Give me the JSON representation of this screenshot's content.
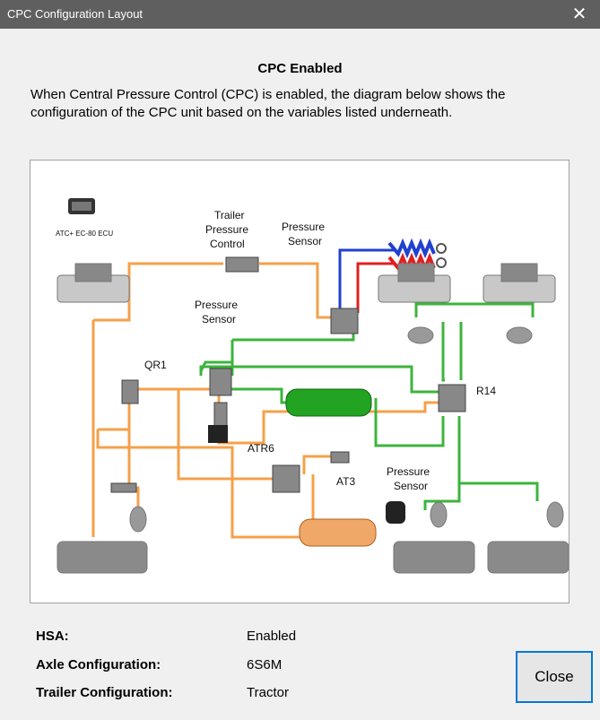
{
  "window": {
    "title": "CPC Configuration Layout",
    "close_glyph": "✕"
  },
  "heading": "CPC Enabled",
  "description": "When Central Pressure Control (CPC) is enabled, the diagram below shows the configuration of the CPC unit based on the variables listed underneath.",
  "diagram": {
    "labels": {
      "ecu": "ATC+ EC-80 ECU",
      "trailer_pressure_control": [
        "Trailer",
        "Pressure",
        "Control"
      ],
      "pressure_sensor_top": [
        "Pressure",
        "Sensor"
      ],
      "pressure_sensor_mid": [
        "Pressure",
        "Sensor"
      ],
      "pressure_sensor_bottom": [
        "Pressure",
        "Sensor"
      ],
      "qr1": "QR1",
      "r14": "R14",
      "atr6": "ATR6",
      "at3": "AT3"
    },
    "colors": {
      "orange_line": "#f5a04a",
      "green_line": "#3cb43c",
      "green_tank": "#22a322",
      "orange_tank": "#f0a868",
      "red_hose": "#e02020",
      "blue_hose": "#2040d0"
    }
  },
  "info": {
    "hsa_label": "HSA:",
    "hsa_value": "Enabled",
    "axle_label": "Axle Configuration:",
    "axle_value": "6S6M",
    "trailer_label": "Trailer Configuration:",
    "trailer_value": "Tractor"
  },
  "buttons": {
    "close_label": "Close"
  }
}
